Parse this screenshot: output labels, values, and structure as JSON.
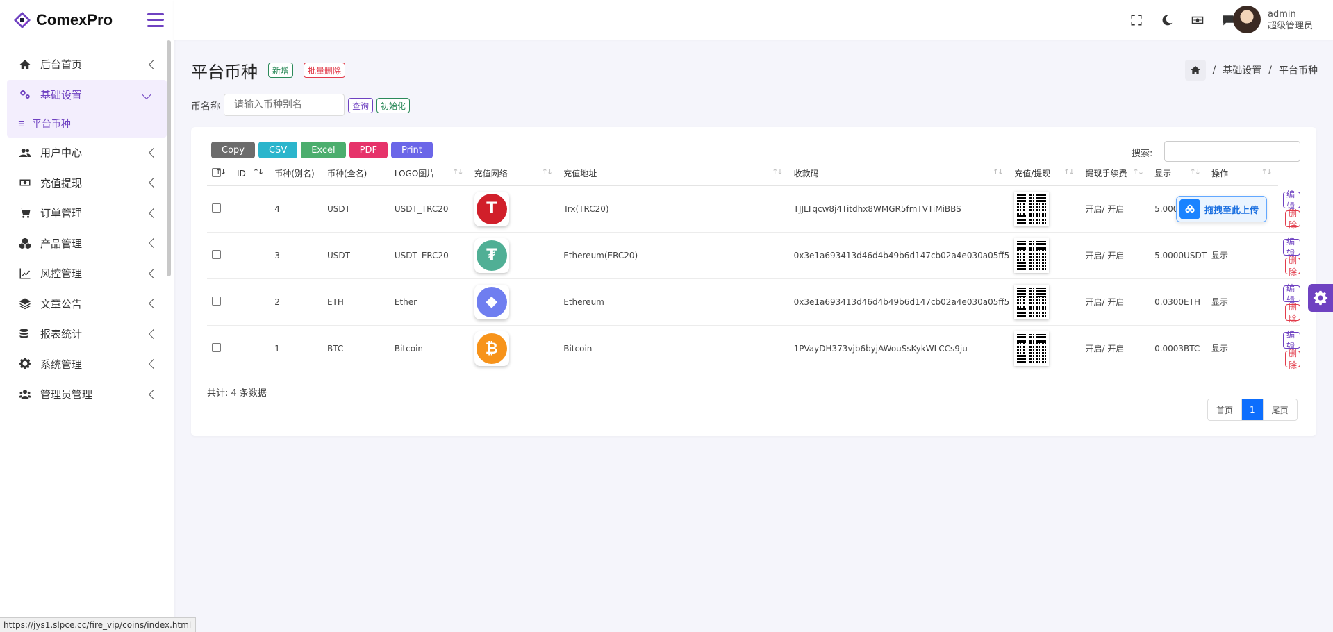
{
  "app": {
    "name": "ComexPro"
  },
  "user": {
    "name": "admin",
    "role": "超级管理员"
  },
  "sidebar": {
    "items": [
      {
        "label": "后台首页",
        "icon": "home-icon"
      },
      {
        "label": "基础设置",
        "icon": "cogs-icon",
        "expanded": true,
        "sub": [
          {
            "label": "平台币种"
          }
        ]
      },
      {
        "label": "用户中心",
        "icon": "users-icon"
      },
      {
        "label": "充值提现",
        "icon": "money-icon"
      },
      {
        "label": "订单管理",
        "icon": "cart-icon"
      },
      {
        "label": "产品管理",
        "icon": "cubes-icon"
      },
      {
        "label": "风控管理",
        "icon": "chart-line-icon"
      },
      {
        "label": "文章公告",
        "icon": "layers-icon"
      },
      {
        "label": "报表统计",
        "icon": "coins-icon"
      },
      {
        "label": "系统管理",
        "icon": "gear-icon"
      },
      {
        "label": "管理员管理",
        "icon": "user-group-icon"
      }
    ]
  },
  "page": {
    "title": "平台币种",
    "new_label": "新增",
    "batch_delete_label": "批量删除",
    "breadcrumb": [
      "基础设置",
      "平台币种"
    ],
    "filter_label": "币名称",
    "filter_placeholder": "请输入币种别名",
    "query_label": "查询",
    "init_label": "初始化"
  },
  "toolbar": {
    "exports": [
      "Copy",
      "CSV",
      "Excel",
      "PDF",
      "Print"
    ],
    "search_label": "搜索:"
  },
  "table": {
    "columns": [
      "ID",
      "币种(别名)",
      "币种(全名)",
      "LOGO图片",
      "充值网络",
      "充值地址",
      "收款码",
      "充值/提现",
      "提现手续费",
      "显示",
      "操作"
    ],
    "rows": [
      {
        "id": "4",
        "alias": "USDT",
        "full": "USDT_TRC20",
        "network": "Trx(TRC20)",
        "address": "TJJLTqcw8j4Titdhx8WMGR5fmTVTiMiBBS",
        "status": "开启/ 开启",
        "fee": "5.0000USDT",
        "show": "显示",
        "logo": "tron-logo",
        "logo_color": "#d11f2a",
        "logo_glyph": "T"
      },
      {
        "id": "3",
        "alias": "USDT",
        "full": "USDT_ERC20",
        "network": "Ethereum(ERC20)",
        "address": "0x3e1a693413d46d4b49b6d147cb02a4e030a05ff5",
        "status": "开启/ 开启",
        "fee": "5.0000USDT",
        "show": "显示",
        "logo": "tether-logo",
        "logo_color": "#50af95",
        "logo_glyph": "₮"
      },
      {
        "id": "2",
        "alias": "ETH",
        "full": "Ether",
        "network": "Ethereum",
        "address": "0x3e1a693413d46d4b49b6d147cb02a4e030a05ff5",
        "status": "开启/ 开启",
        "fee": "0.0300ETH",
        "show": "显示",
        "logo": "ethereum-logo",
        "logo_color": "#6f7ef0",
        "logo_glyph": "◆"
      },
      {
        "id": "1",
        "alias": "BTC",
        "full": "Bitcoin",
        "network": "Bitcoin",
        "address": "1PVayDH373vjb6byjAWouSsKykWLCCs9ju",
        "status": "开启/ 开启",
        "fee": "0.0003BTC",
        "show": "显示",
        "logo": "bitcoin-logo",
        "logo_color": "#f7931a",
        "logo_glyph": "₿"
      }
    ],
    "edit_label": "编辑",
    "delete_label": "删除"
  },
  "footer": {
    "total": "共计: 4 条数据",
    "pager": [
      "首页",
      "1",
      "尾页"
    ]
  },
  "overlay": {
    "upload_label": "拖拽至此上传"
  },
  "status_url": "https://jys1.slpce.cc/fire_vip/coins/index.html",
  "colors": {
    "accent": "#6f42c1",
    "danger": "#e23c4b",
    "success": "#2c8a5a",
    "primary": "#0d6efd"
  }
}
